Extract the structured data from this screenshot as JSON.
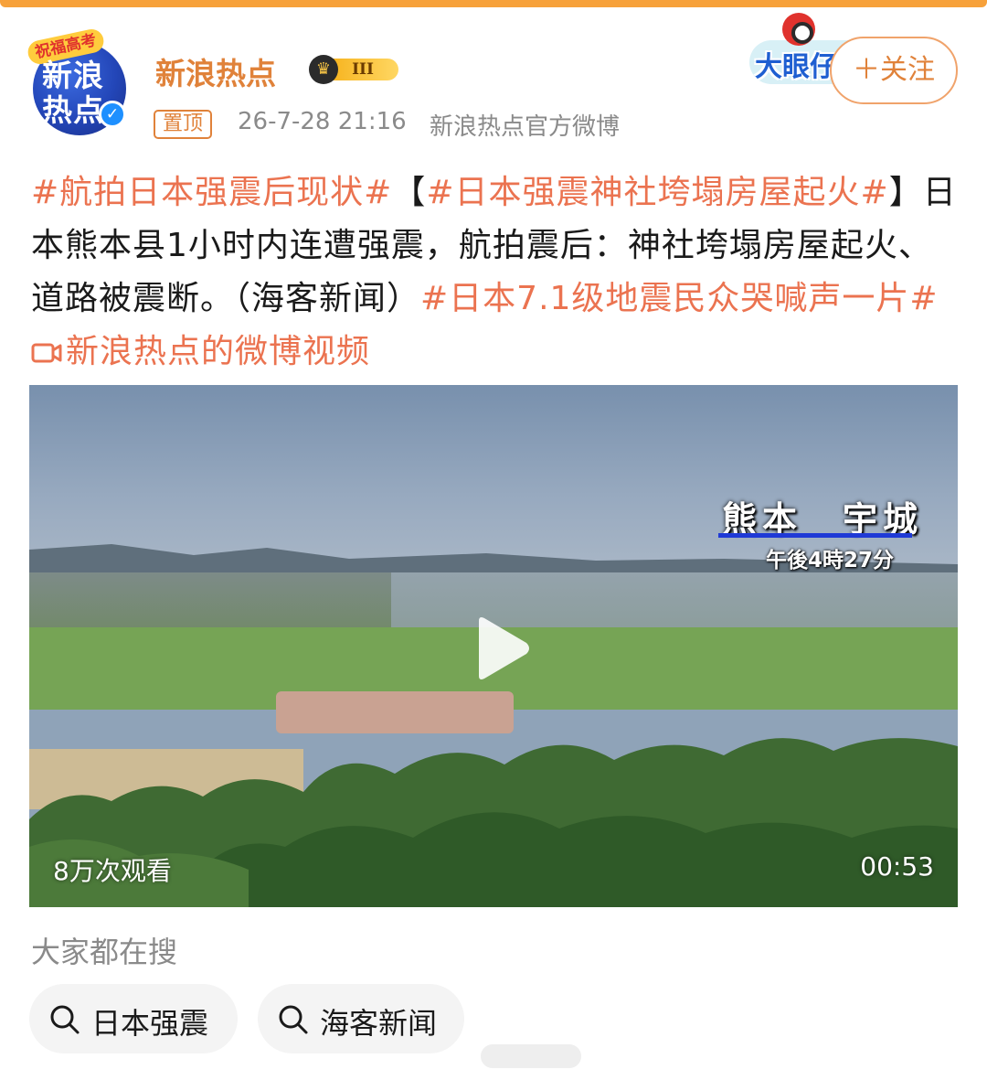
{
  "header": {
    "avatar_text": "新浪热点",
    "avatar_ribbon": "祝福高考",
    "username": "新浪热点",
    "level_label": "III",
    "pin_label": "置顶",
    "timestamp": "26-7-28 21:16",
    "source": "新浪热点官方微博",
    "event_badge_text": "大眼仔",
    "follow_label": "＋关注"
  },
  "post": {
    "segments": [
      {
        "text": "#航拍日本强震后现状#",
        "type": "hashtag"
      },
      {
        "text": "【",
        "type": "plain"
      },
      {
        "text": "#日本强震神社垮塌房屋起火#",
        "type": "hashtag"
      },
      {
        "text": "】日本熊本县1小时内连遭强震，航拍震后：神社垮塌房屋起火、道路被震断。（海客新闻）",
        "type": "plain"
      },
      {
        "text": "#日本7.1级地震民众哭喊声一片#",
        "type": "hashtag"
      },
      {
        "text": " ",
        "type": "plain"
      },
      {
        "text": "新浪热点的微博视频",
        "type": "video-link"
      }
    ]
  },
  "video": {
    "place_overlay": "熊本　宇城",
    "time_overlay": "午後4時27分",
    "views": "8万次观看",
    "duration": "00:53"
  },
  "search": {
    "title": "大家都在搜",
    "chips": [
      "日本强震",
      "海客新闻"
    ]
  },
  "colors": {
    "accent": "#e0823a",
    "link": "#eb7350",
    "meta_gray": "#8a8a8a"
  }
}
